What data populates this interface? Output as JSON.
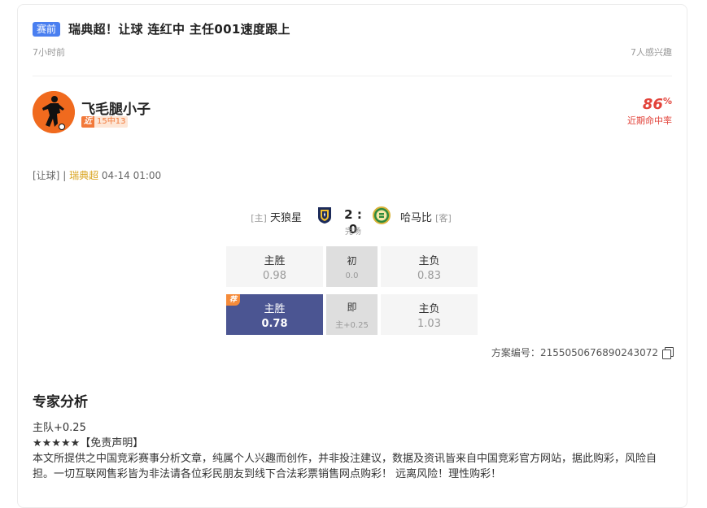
{
  "post": {
    "tag": "赛前",
    "title": "瑞典超！让球 连红中 主任001速度跟上",
    "time": "7小时前",
    "interest": "7人感兴趣"
  },
  "expert": {
    "name": "飞毛腿小子",
    "streak_tag": "近",
    "streak_record": "15中13",
    "hit_rate": "86",
    "hit_rate_unit": "%",
    "hit_rate_label": "近期命中率"
  },
  "match": {
    "type": "[让球]",
    "separator": "|",
    "league": "瑞典超",
    "datetime": "04-14 01:00",
    "home_role": "[主]",
    "home_team": "天狼星",
    "away_team": "哈马比",
    "away_role": "[客]",
    "score": "2 : 0",
    "status": "完场"
  },
  "odds": {
    "initial": {
      "home_label": "主胜",
      "home_value": "0.98",
      "mid_label": "初",
      "mid_value": "0.0",
      "away_label": "主负",
      "away_value": "0.83"
    },
    "live": {
      "badge": "荐",
      "home_label": "主胜",
      "home_value": "0.78",
      "mid_label": "即",
      "mid_value": "主+0.25",
      "away_label": "主负",
      "away_value": "1.03"
    }
  },
  "plan": {
    "label": "方案编号：",
    "number": "2155050676890243072"
  },
  "analysis": {
    "title": "专家分析",
    "line1": "主队+0.25",
    "line2": "★★★★★【免责声明】",
    "line3": "本文所提供之中国竞彩赛事分析文章，纯属个人兴趣而创作，并非投注建议，数据及资讯皆来自中国竞彩官方网站，据此购彩，风险自担。一切互联网售彩皆为非法请各位彩民朋友到线下合法彩票销售网点购彩！ 远离风险！理性购彩！"
  },
  "colors": {
    "tag": "#4a7ff0",
    "hit_rate": "#e2433a",
    "league": "#d9a31c",
    "selected_odds": "#4b5592",
    "badge": "#f58b3a",
    "avatar_bg": "#f06a1e"
  },
  "icons": {
    "copy": "copy-icon",
    "home_logo": "sirius-logo",
    "away_logo": "hammarby-logo",
    "avatar": "footballer-avatar"
  }
}
